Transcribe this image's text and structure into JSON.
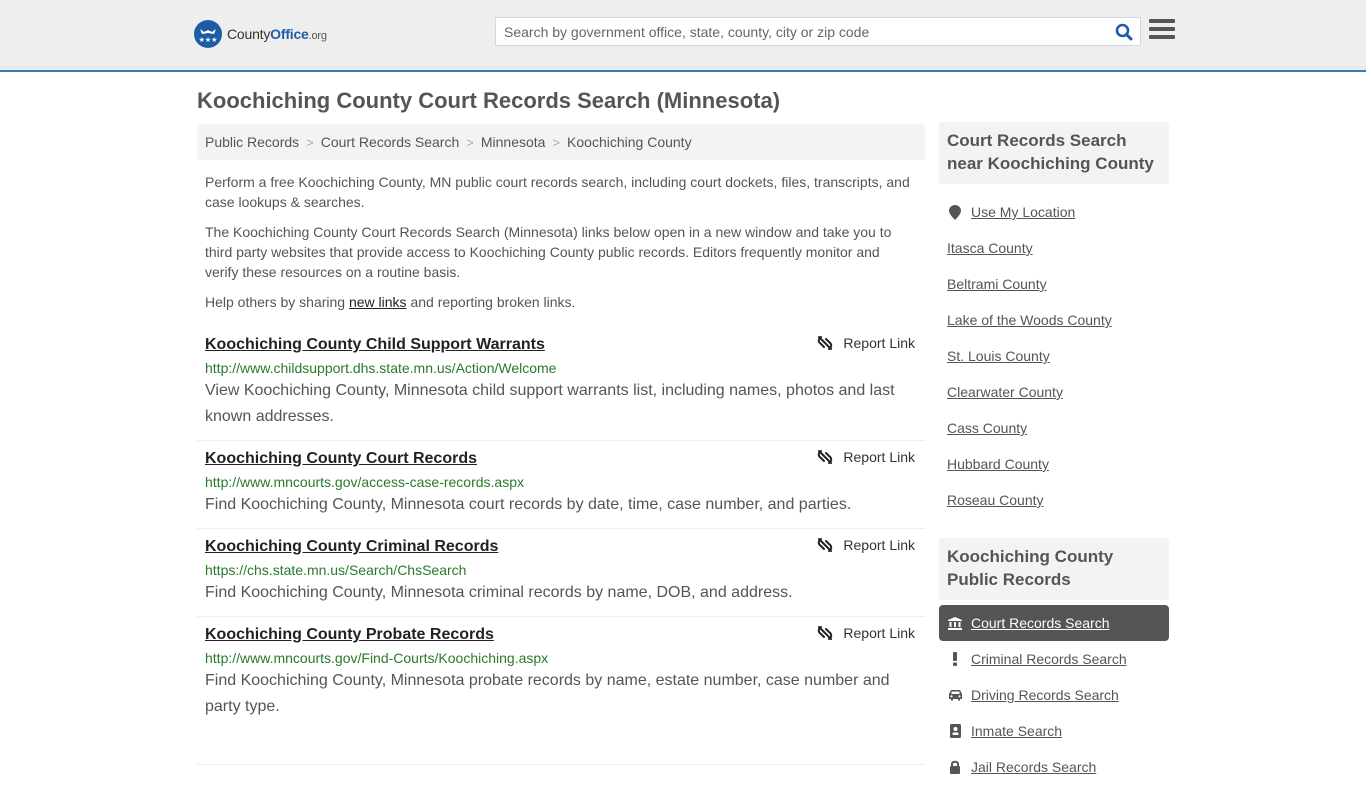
{
  "header": {
    "logo": {
      "text_pre": "County",
      "text_brand": "Office",
      "text_suffix": ".org"
    },
    "search": {
      "placeholder": "Search by government office, state, county, city or zip code",
      "value": ""
    },
    "colors": {
      "brand": "#1e5ca8",
      "accent_line": "#3a7cb0",
      "url_green": "#2a7a2a"
    }
  },
  "page": {
    "title": "Koochiching County Court Records Search (Minnesota)"
  },
  "breadcrumb": [
    {
      "label": "Public Records"
    },
    {
      "label": "Court Records Search"
    },
    {
      "label": "Minnesota"
    },
    {
      "label": "Koochiching County"
    }
  ],
  "intro": {
    "p1": "Perform a free Koochiching County, MN public court records search, including court dockets, files, transcripts, and case lookups & searches.",
    "p2": "The Koochiching County Court Records Search (Minnesota) links below open in a new window and take you to third party websites that provide access to Koochiching County public records. Editors frequently monitor and verify these resources on a routine basis.",
    "p3_pre": "Help others by sharing ",
    "p3_link": "new links",
    "p3_post": " and reporting broken links."
  },
  "results": [
    {
      "title": "Koochiching County Child Support Warrants",
      "url": "http://www.childsupport.dhs.state.mn.us/Action/Welcome",
      "description": "View Koochiching County, Minnesota child support warrants list, including names, photos and last known addresses.",
      "report_label": "Report Link"
    },
    {
      "title": "Koochiching County Court Records",
      "url": "http://www.mncourts.gov/access-case-records.aspx",
      "description": "Find Koochiching County, Minnesota court records by date, time, case number, and parties.",
      "report_label": "Report Link"
    },
    {
      "title": "Koochiching County Criminal Records",
      "url": "https://chs.state.mn.us/Search/ChsSearch",
      "description": "Find Koochiching County, Minnesota criminal records by name, DOB, and address.",
      "report_label": "Report Link"
    },
    {
      "title": "Koochiching County Probate Records",
      "url": "http://www.mncourts.gov/Find-Courts/Koochiching.aspx",
      "description": "Find Koochiching County, Minnesota probate records by name, estate number, case number and party type.",
      "report_label": "Report Link"
    }
  ],
  "sidebar": {
    "near_heading": "Court Records Search near Koochiching County",
    "use_location": {
      "label": "Use My Location",
      "icon": "map-marker-icon"
    },
    "near_counties": [
      {
        "label": "Itasca County"
      },
      {
        "label": "Beltrami County"
      },
      {
        "label": "Lake of the Woods County"
      },
      {
        "label": "St. Louis County"
      },
      {
        "label": "Clearwater County"
      },
      {
        "label": "Cass County"
      },
      {
        "label": "Hubbard County"
      },
      {
        "label": "Roseau County"
      }
    ],
    "public_heading": "Koochiching County Public Records",
    "public_links": [
      {
        "label": "Court Records Search",
        "icon": "courthouse-icon",
        "active": true
      },
      {
        "label": "Criminal Records Search",
        "icon": "exclamation-icon",
        "active": false
      },
      {
        "label": "Driving Records Search",
        "icon": "car-icon",
        "active": false
      },
      {
        "label": "Inmate Search",
        "icon": "id-badge-icon",
        "active": false
      },
      {
        "label": "Jail Records Search",
        "icon": "lock-icon",
        "active": false
      }
    ]
  }
}
